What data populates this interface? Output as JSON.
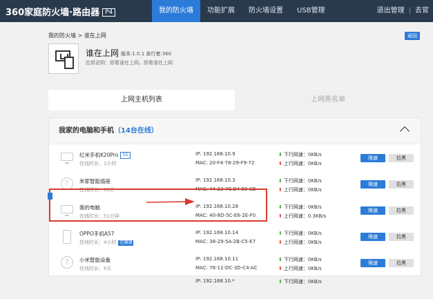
{
  "header": {
    "logo_text": "360家庭防火墙·路由器",
    "logo_badge": "P4",
    "nav": [
      {
        "label": "我的防火墙",
        "active": true
      },
      {
        "label": "功能扩展",
        "active": false
      },
      {
        "label": "防火墙设置",
        "active": false
      },
      {
        "label": "USB管理",
        "active": false
      }
    ],
    "logout": "退出管理",
    "separator": "|",
    "extra": "去官"
  },
  "breadcrumb": "我的防火墙 > 谁在上网",
  "back_label": "返回",
  "app": {
    "title": "谁在上网",
    "version": "版本:1.0.1   发行者:360",
    "description": "应用说明：即看谁在上网，即看谁在上网"
  },
  "tabs": [
    {
      "label": "上网主机列表",
      "active": true
    },
    {
      "label": "上网黑名单",
      "active": false
    }
  ],
  "panel": {
    "title": "我家的电脑和手机",
    "online_count": "（14台在线）"
  },
  "row_labels": {
    "limit": "限速",
    "blacklist": "拉黑",
    "down_arrow": "⬇",
    "up_arrow": "⬆"
  },
  "devices": [
    {
      "name": "红米手机K20Pro",
      "tag": "5G",
      "time": "在线时长：1小时",
      "ip": "IP: 192.168.10.9",
      "mac": "MAC: 20-F4-78-29-F9-72",
      "down": "下行网速：0KB/s",
      "up": "上行网速：0KB/s",
      "icon": "monitor-icon"
    },
    {
      "name": "米家智能插座",
      "tag": "",
      "time": "在线时长：16天",
      "ip": "IP: 192.168.10.3",
      "mac": "MAC: 44-23-7C-B4-90-CB",
      "down": "下行网速：0KB/s",
      "up": "上行网速：0KB/s",
      "icon": "question-icon"
    },
    {
      "name": "我的电脑",
      "tag": "",
      "time": "在线时长：51分钟",
      "ip": "IP: 192.168.10.28",
      "mac": "MAC: 40-8D-5C-E6-2E-F0",
      "down": "下行网速：0KB/s",
      "up": "上行网速：0.3KB/s",
      "icon": "monitor-icon"
    },
    {
      "name": "OPPO手机A57",
      "tag": "已限速",
      "time": "在线时长：4小时",
      "ip": "IP: 192.168.10.14",
      "mac": "MAC: 38-29-5A-2B-C5-E7",
      "down": "下行网速：0KB/s",
      "up": "上行网速：0KB/s",
      "icon": "phone-icon"
    },
    {
      "name": "小米智能设备",
      "tag": "",
      "time": "在线时长：6天",
      "ip": "IP: 192.168.10.11",
      "mac": "MAC: 78-11-DC-3D-C4-AC",
      "down": "下行网速：0KB/s",
      "up": "上行网速：0KB/s",
      "icon": "question-icon"
    },
    {
      "name": "",
      "tag": "",
      "time": "",
      "ip": "IP: 192.168.10.*",
      "mac": "",
      "down": "下行网速：0KB/s",
      "up": "",
      "icon": ""
    }
  ],
  "colors": {
    "accent": "#2b7bd9",
    "topbar": "#2a3a4d",
    "highlight": "#d9382e"
  }
}
